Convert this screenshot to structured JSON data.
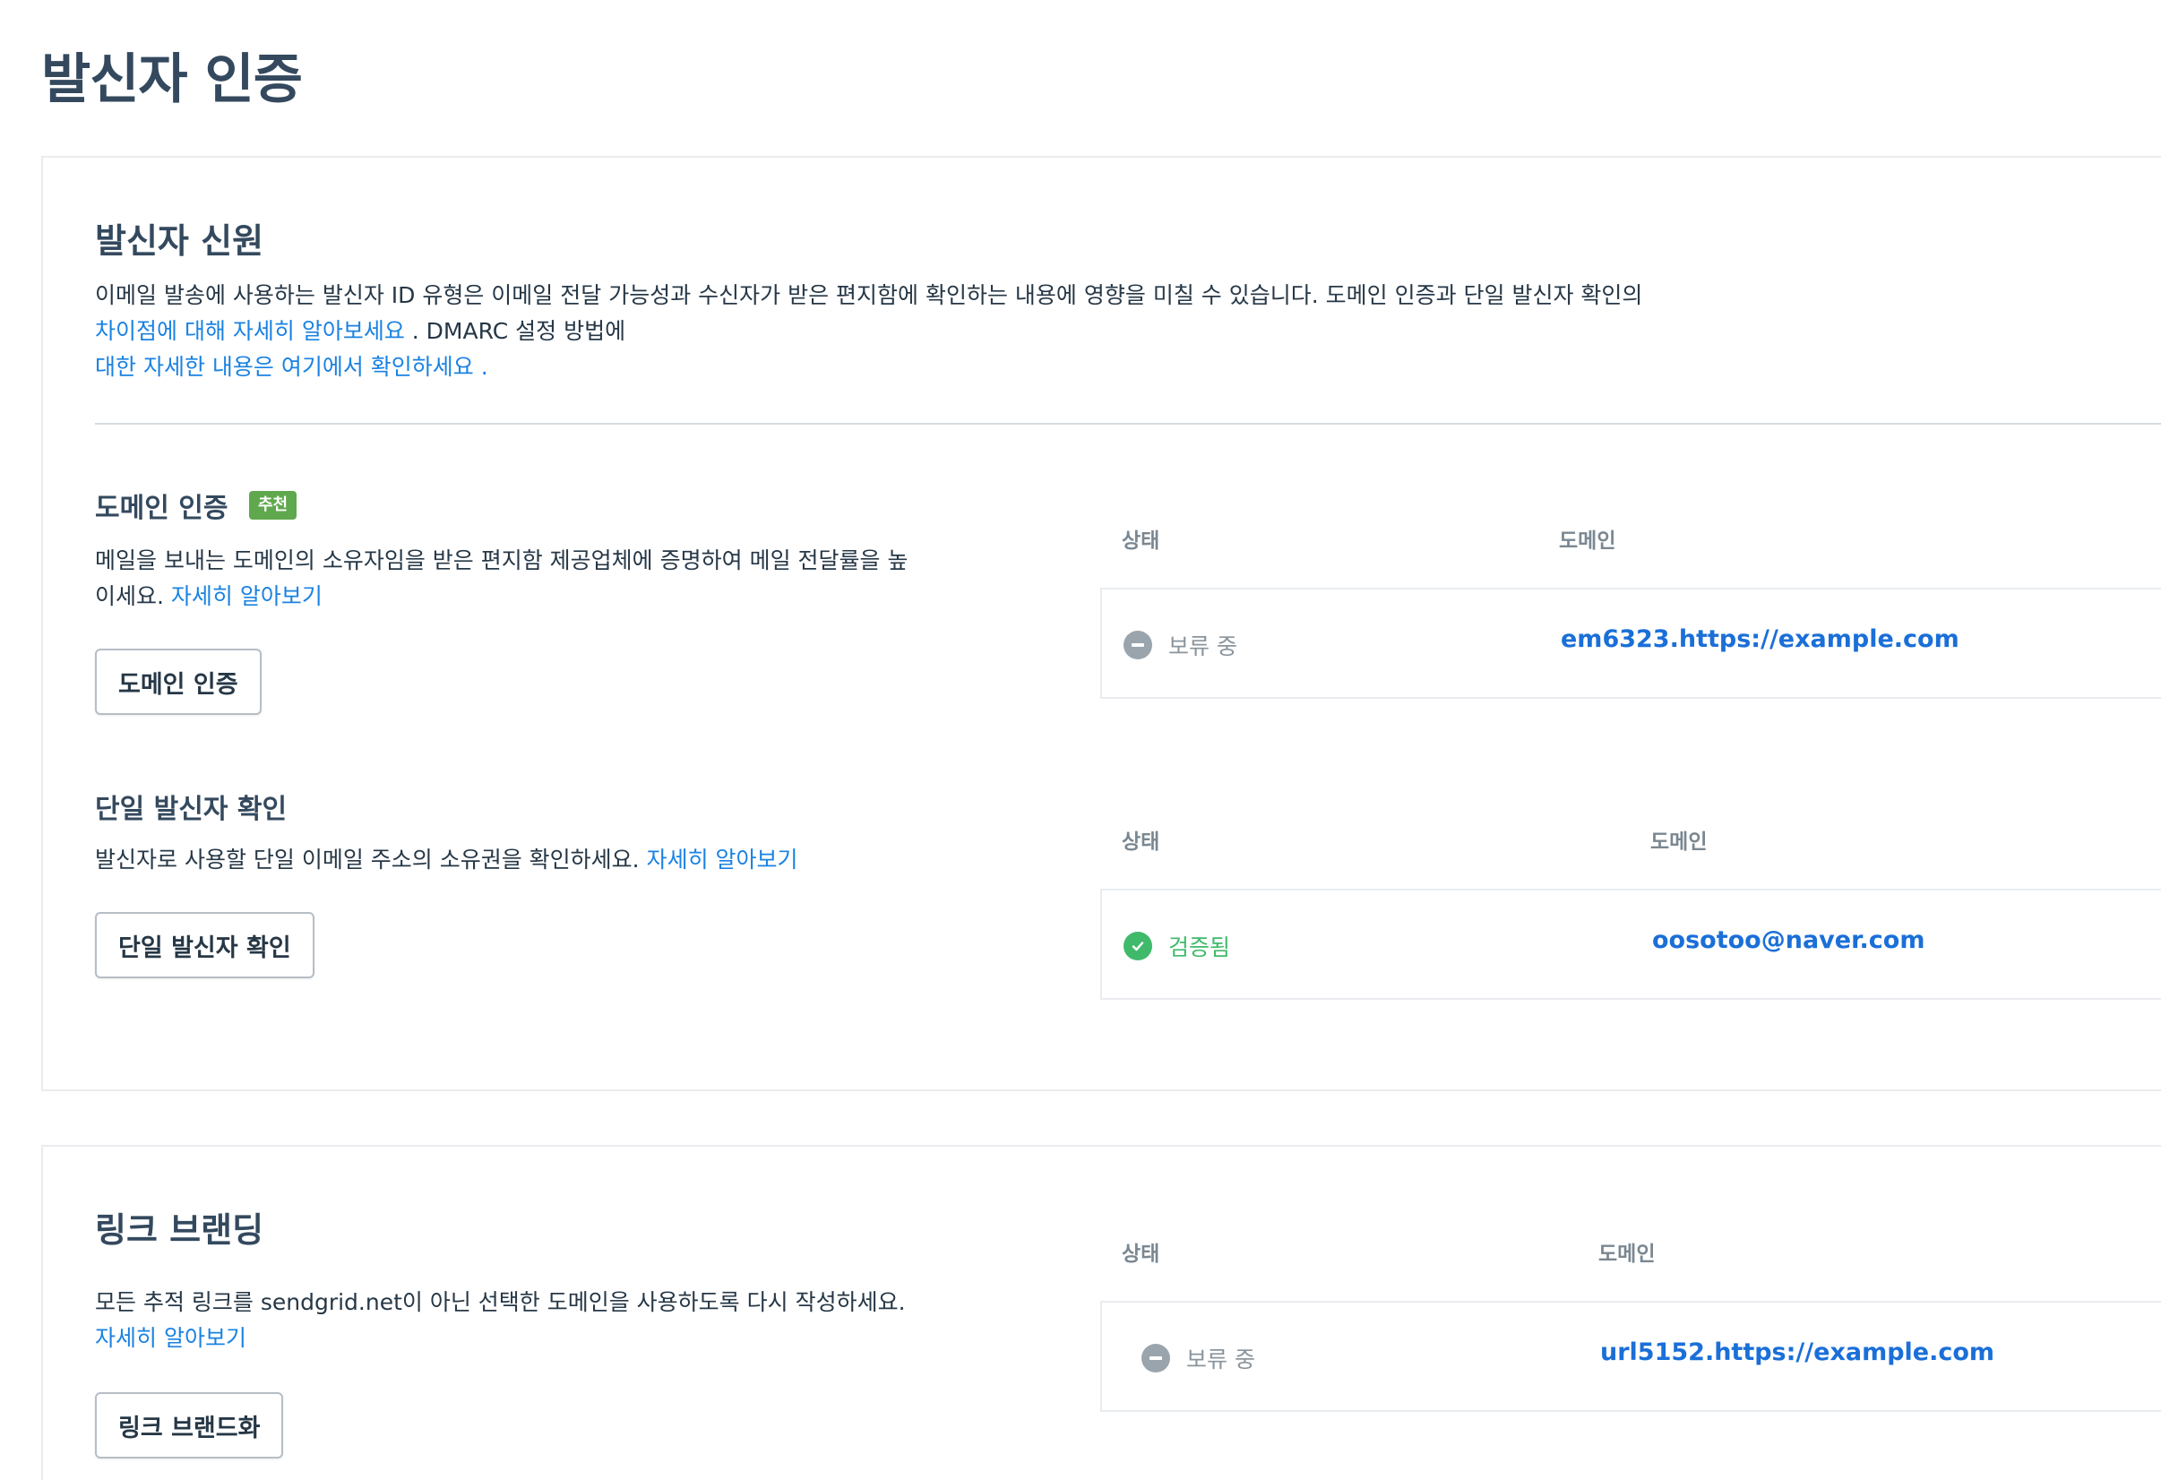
{
  "page": {
    "title": "발신자 인증"
  },
  "sender_identity": {
    "title": "발신자 신원",
    "description": "이메일 발송에 사용하는 발신자 ID 유형은 이메일 전달 가능성과 수신자가 받은 편지함에 확인하는 내용에 영향을 미칠 수 있습니다. 도메인 인증과 단일 발신자 확인의",
    "learn_diff_link": "차이점에 대해 자세히 알아보세요",
    "dmarc_text": " . DMARC 설정 방법에",
    "dmarc_link": "대한 자세한 내용은 여기에서 확인하세요 ."
  },
  "domain_auth": {
    "title": "도메인 인증",
    "badge": "추천",
    "description": "메일을 보내는 도메인의 소유자임을 받은 편지함 제공업체에 증명하여 메일 전달률을 높이세요.",
    "learn_more": "자세히 알아보기",
    "button": "도메인 인증",
    "table": {
      "col_status": "상태",
      "col_domain": "도메인",
      "row": {
        "status": "보류 중",
        "status_type": "pending",
        "domain": "em6323.https://example.com"
      }
    }
  },
  "single_sender": {
    "title": "단일 발신자 확인",
    "description": "발신자로 사용할 단일 이메일 주소의 소유권을 확인하세요.",
    "learn_more": "자세히 알아보기",
    "button": "단일 발신자 확인",
    "table": {
      "col_status": "상태",
      "col_domain": "도메인",
      "row": {
        "status": "검증됨",
        "status_type": "verified",
        "domain": "oosotoo@naver.com"
      }
    }
  },
  "link_branding": {
    "title": "링크 브랜딩",
    "description": "모든 추적 링크를 sendgrid.net이 아닌 선택한 도메인을 사용하도록 다시 작성하세요.",
    "learn_more": "자세히 알아보기",
    "button": "링크 브랜드화",
    "table": {
      "col_status": "상태",
      "col_domain": "도메인",
      "row": {
        "status": "보류 중",
        "status_type": "pending",
        "domain": "url5152.https://example.com"
      }
    }
  },
  "colors": {
    "link": "#1a82e2",
    "badge": "#60a84d",
    "verified": "#3fba6a",
    "pending": "#9aa4ad",
    "heading": "#34495e"
  },
  "icons": {
    "pending": "minus-circle-icon",
    "verified": "check-circle-icon"
  }
}
